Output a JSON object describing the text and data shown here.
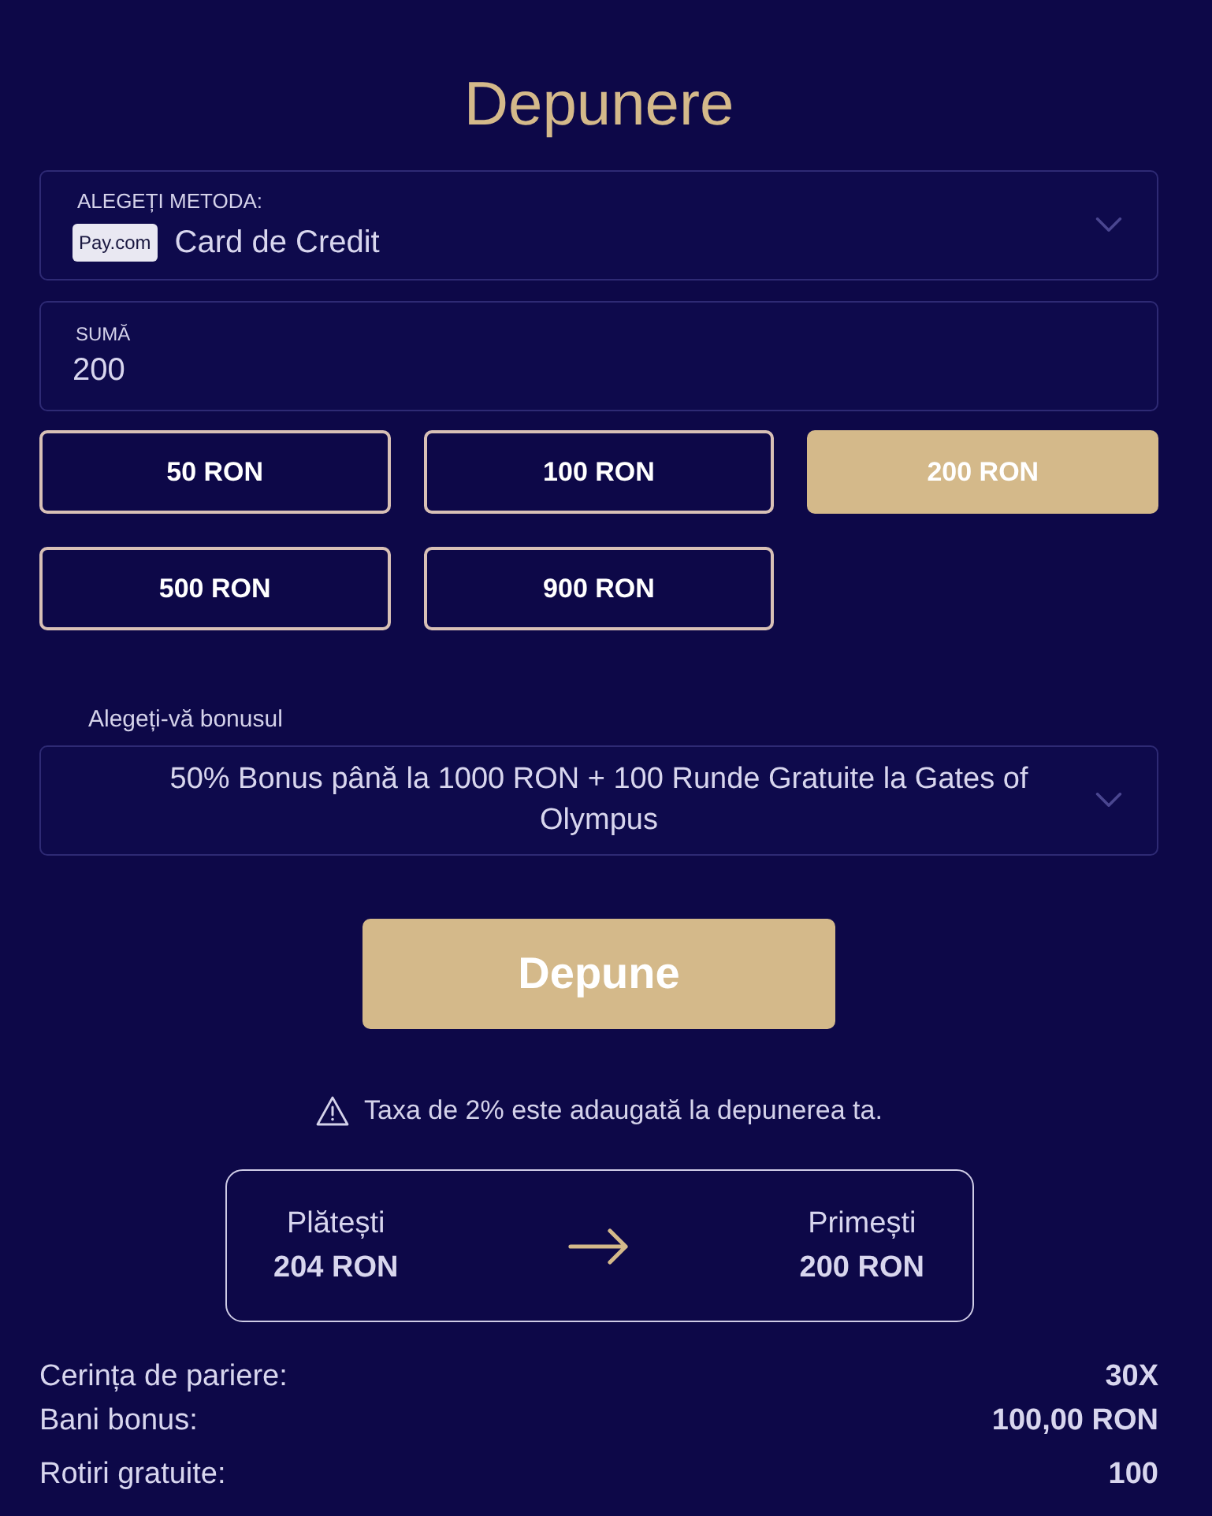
{
  "title": "Depunere",
  "method": {
    "label": "ALEGEȚI METODA:",
    "logo": "Pay.com",
    "value": "Card de Credit"
  },
  "amount": {
    "label": "SUMĂ",
    "value": "200"
  },
  "presets": [
    {
      "label": "50 RON",
      "selected": false
    },
    {
      "label": "100 RON",
      "selected": false
    },
    {
      "label": "200 RON",
      "selected": true
    },
    {
      "label": "500 RON",
      "selected": false
    },
    {
      "label": "900 RON",
      "selected": false
    }
  ],
  "bonus": {
    "label": "Alegeți-vă bonusul",
    "value": "50% Bonus până la 1000 RON + 100 Runde Gratuite la Gates of Olympus"
  },
  "submit": "Depune",
  "notice": "Taxa de 2% este adaugată la depunerea ta.",
  "summary": {
    "pay_label": "Plătești",
    "pay_amount": "204 RON",
    "receive_label": "Primești",
    "receive_amount": "200 RON"
  },
  "details": [
    {
      "label": "Cerința de pariere:",
      "value": "30X"
    },
    {
      "label": "Bani bonus:",
      "value": "100,00 RON"
    },
    {
      "label": "Rotiri gratuite:",
      "value": "100"
    }
  ]
}
